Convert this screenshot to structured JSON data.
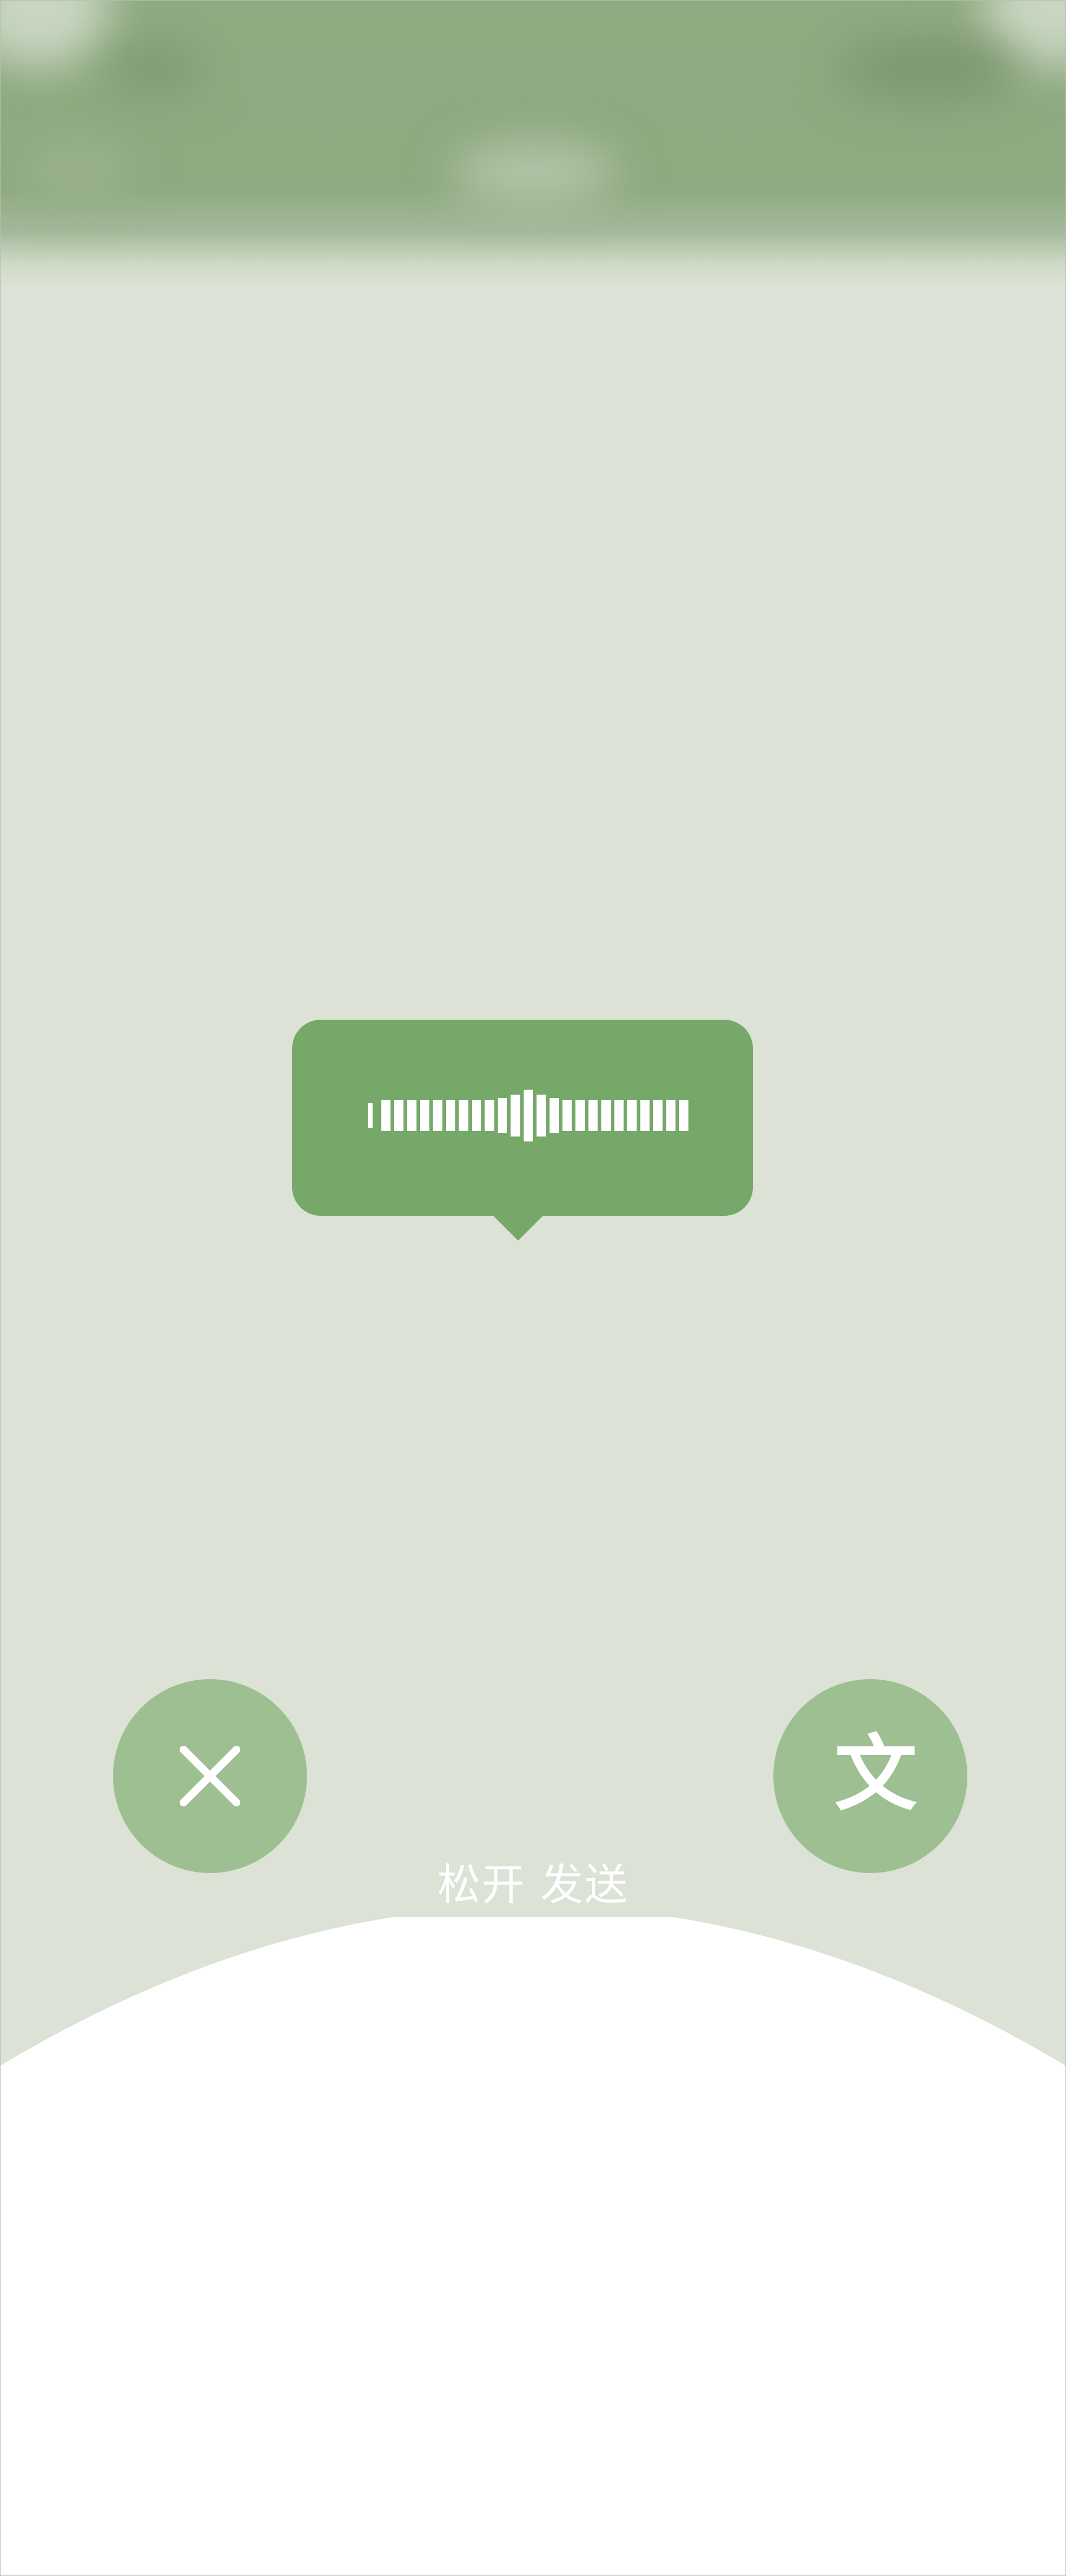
{
  "voice_record": {
    "release_hint": "松开 发送",
    "translate_button_label": "文",
    "cancel_icon": "close-icon",
    "waveform_icon": "audio-waveform-icon"
  },
  "colors": {
    "header_green": "#8fab82",
    "overlay_background": "#dce2d5",
    "bubble_green": "#76a86a",
    "button_green": "#9ebf92",
    "panel_white": "#ffffff"
  }
}
